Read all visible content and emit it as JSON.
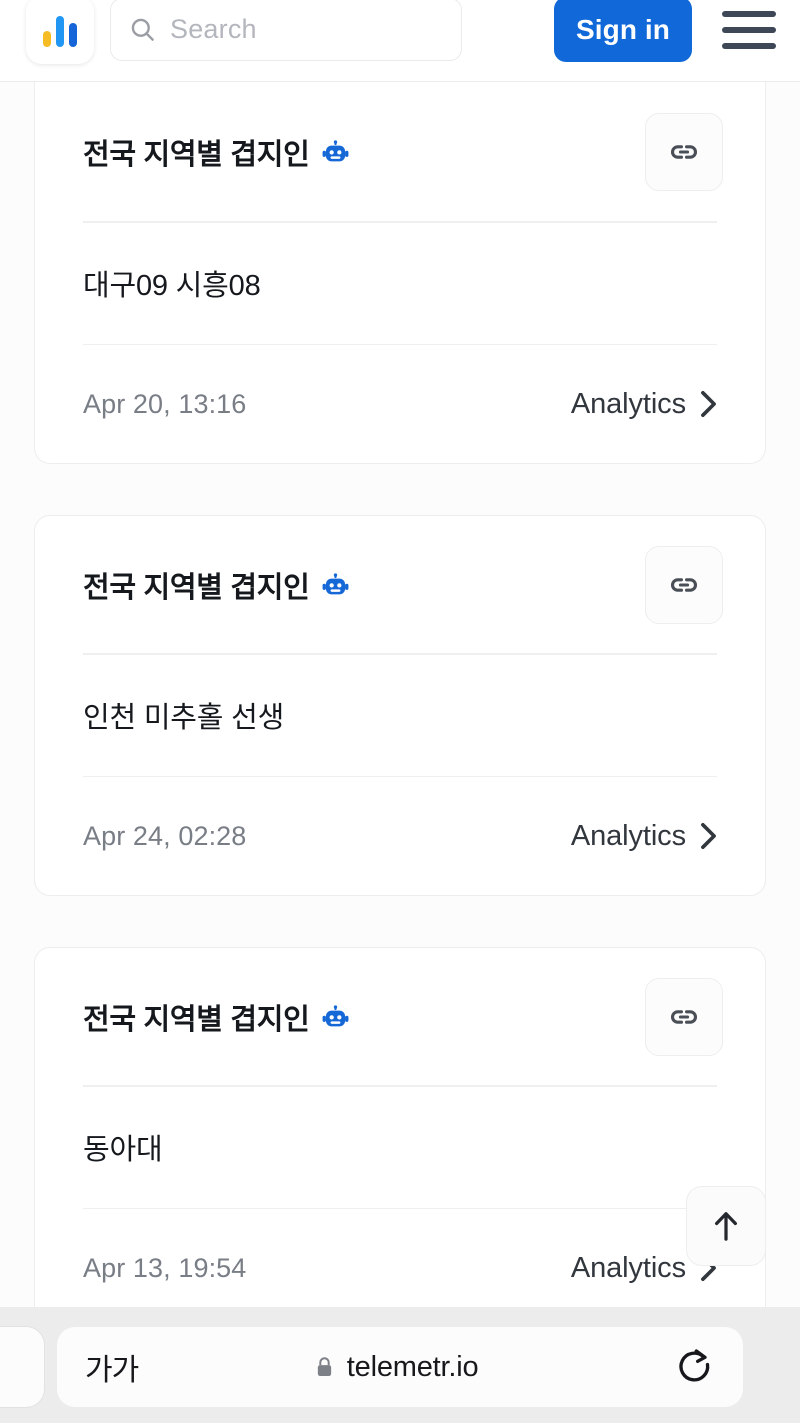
{
  "header": {
    "logo_name": "telemetrio-logo",
    "logo_colors": [
      "#f5bc24",
      "#2196f3",
      "#1565d8"
    ],
    "search": {
      "placeholder": "Search",
      "value": "",
      "icon": "search-icon"
    },
    "signin_label": "Sign in",
    "signin_color": "#1068d9",
    "menu_icon": "hamburger-menu-icon"
  },
  "cards": [
    {
      "title": "전국 지역별 겹지인",
      "title_emoji": "robot-face-emoji",
      "link_icon": "link-icon",
      "name": "대구09 시흥08",
      "date": "Apr 20, 13:16",
      "analytics_label": "Analytics",
      "analytics_icon": "chevron-right-icon"
    },
    {
      "title": "전국 지역별 겹지인",
      "title_emoji": "robot-face-emoji",
      "link_icon": "link-icon",
      "name": "인천 미추홀 선생",
      "date": "Apr 24, 02:28",
      "analytics_label": "Analytics",
      "analytics_icon": "chevron-right-icon"
    },
    {
      "title": "전국 지역별 겹지인",
      "title_emoji": "robot-face-emoji",
      "link_icon": "link-icon",
      "name": "동아대",
      "date": "Apr 13, 19:54",
      "analytics_label": "Analytics",
      "analytics_icon": "chevron-right-icon"
    }
  ],
  "scroll_top": {
    "icon": "arrow-up-icon"
  },
  "browser_bar": {
    "text_size_label": "가가",
    "lock_icon": "lock-icon",
    "url": "telemetr.io",
    "reload_icon": "reload-icon"
  }
}
